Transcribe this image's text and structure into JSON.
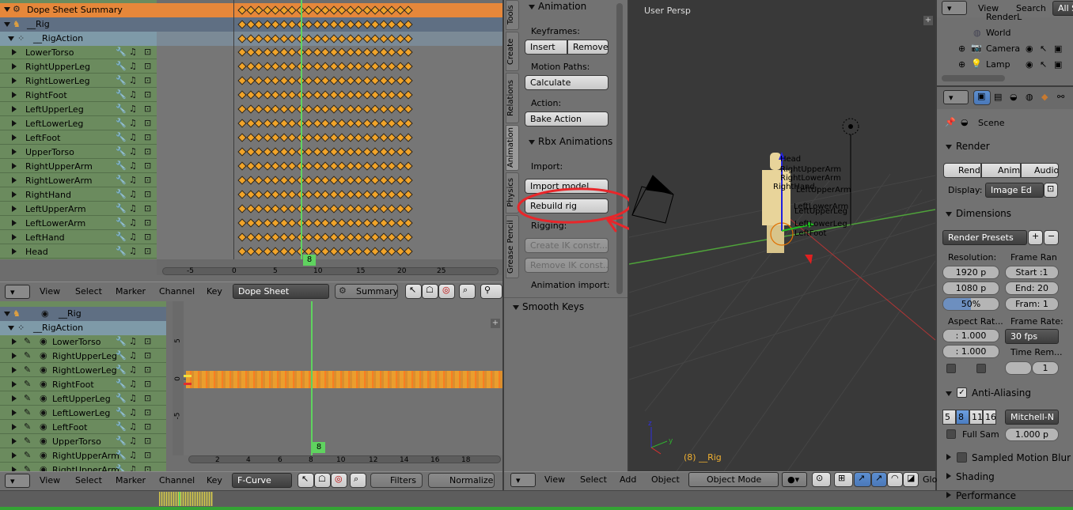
{
  "dopesheet": {
    "summary_label": "Dope Sheet Summary",
    "rig_label": "__Rig",
    "action_label": "__RigAction",
    "channels": [
      "LowerTorso",
      "RightUpperLeg",
      "RightLowerLeg",
      "RightFoot",
      "LeftUpperLeg",
      "LeftLowerLeg",
      "LeftFoot",
      "UpperTorso",
      "RightUpperArm",
      "RightLowerArm",
      "RightHand",
      "LeftUpperArm",
      "LeftLowerArm",
      "LeftHand",
      "Head"
    ],
    "current_frame": "8",
    "ruler": [
      "-5",
      "0",
      "5",
      "10",
      "15",
      "20",
      "25"
    ],
    "header": {
      "view": "View",
      "select": "Select",
      "marker": "Marker",
      "channel": "Channel",
      "key": "Key",
      "mode": "Dope Sheet",
      "summary": "Summary"
    }
  },
  "graph": {
    "rig_label": "__Rig",
    "action_label": "__RigAction",
    "channels": [
      "LowerTorso",
      "RightUpperLeg",
      "RightLowerLeg",
      "RightFoot",
      "LeftUpperLeg",
      "LeftLowerLeg",
      "LeftFoot",
      "UpperTorso",
      "RightUpperArm",
      "RightUpperArm"
    ],
    "current_frame": "8",
    "y_ticks": [
      "5",
      "0",
      "-5"
    ],
    "ruler": [
      "2",
      "4",
      "6",
      "8",
      "10",
      "12",
      "14",
      "16",
      "18"
    ],
    "header": {
      "view": "View",
      "select": "Select",
      "marker": "Marker",
      "channel": "Channel",
      "key": "Key",
      "mode": "F-Curve",
      "filters": "Filters",
      "normalize": "Normalize"
    }
  },
  "toolshelf": {
    "tabs": [
      "Tools",
      "Create",
      "Relations",
      "Animation",
      "Physics",
      "Grease Pencil"
    ],
    "animation_title": "Animation",
    "keyframes_label": "Keyframes:",
    "insert": "Insert",
    "remove": "Remove",
    "motion_paths_label": "Motion Paths:",
    "calculate": "Calculate",
    "action_label": "Action:",
    "bake_action": "Bake Action",
    "rbx_title": "Rbx Animations",
    "import_label": "Import:",
    "import_model": "Import model",
    "rebuild_rig": "Rebuild rig",
    "rigging_label": "Rigging:",
    "create_ik": "Create IK constr...",
    "remove_ik": "Remove IK const...",
    "animation_import_label": "Animation import:",
    "smooth_keys": "Smooth Keys"
  },
  "viewport": {
    "title": "User Persp",
    "status": "(8) __Rig",
    "bone_labels": [
      "Head",
      "RightUpperArm",
      "RightLowerArm",
      "RightHand",
      "LeftUpperArm",
      "LeftLowerArm",
      "LeftUpperLeg",
      "LeftLowerLeg",
      "LeftFoot"
    ],
    "header": {
      "view": "View",
      "select": "Select",
      "add": "Add",
      "object": "Object",
      "mode": "Object Mode",
      "global": "Glo"
    }
  },
  "outliner": {
    "view": "View",
    "search": "Search",
    "all_scenes": "All S",
    "items": [
      "RenderL",
      "World",
      "Camera",
      "Lamp"
    ]
  },
  "properties": {
    "scene": "Scene",
    "render_title": "Render",
    "render_btn": "Rende",
    "anim_btn": "Anima",
    "audio_btn": "Audio",
    "display_label": "Display:",
    "display_value": "Image Ed",
    "dimensions_title": "Dimensions",
    "render_presets": "Render Presets",
    "resolution_label": "Resolution:",
    "res_x": "1920 p",
    "res_y": "1080 p",
    "res_pct": "50%",
    "frame_range_label": "Frame Ran",
    "start": "Start :1",
    "end": "End: 20",
    "frame_step": "Fram: 1",
    "aspect_label": "Aspect Rat...",
    "aspect_x": ": 1.000",
    "aspect_y": ": 1.000",
    "frame_rate_label": "Frame Rate:",
    "fps": "30 fps",
    "time_remap_label": "Time Rem...",
    "time_remap_val": "1",
    "aa_title": "Anti-Aliasing",
    "aa_samples": [
      "5",
      "8",
      "11",
      "16"
    ],
    "aa_filter": "Mitchell-N",
    "full_sample": "Full Sam",
    "filter_size": "1.000 p",
    "motion_blur": "Sampled Motion Blur",
    "shading": "Shading",
    "performance": "Performance"
  },
  "colors": {
    "annotation": "#e8262a",
    "keyframe": "#f1a42a",
    "playhead": "#5fd35f",
    "summary_row": "#e6873a"
  }
}
